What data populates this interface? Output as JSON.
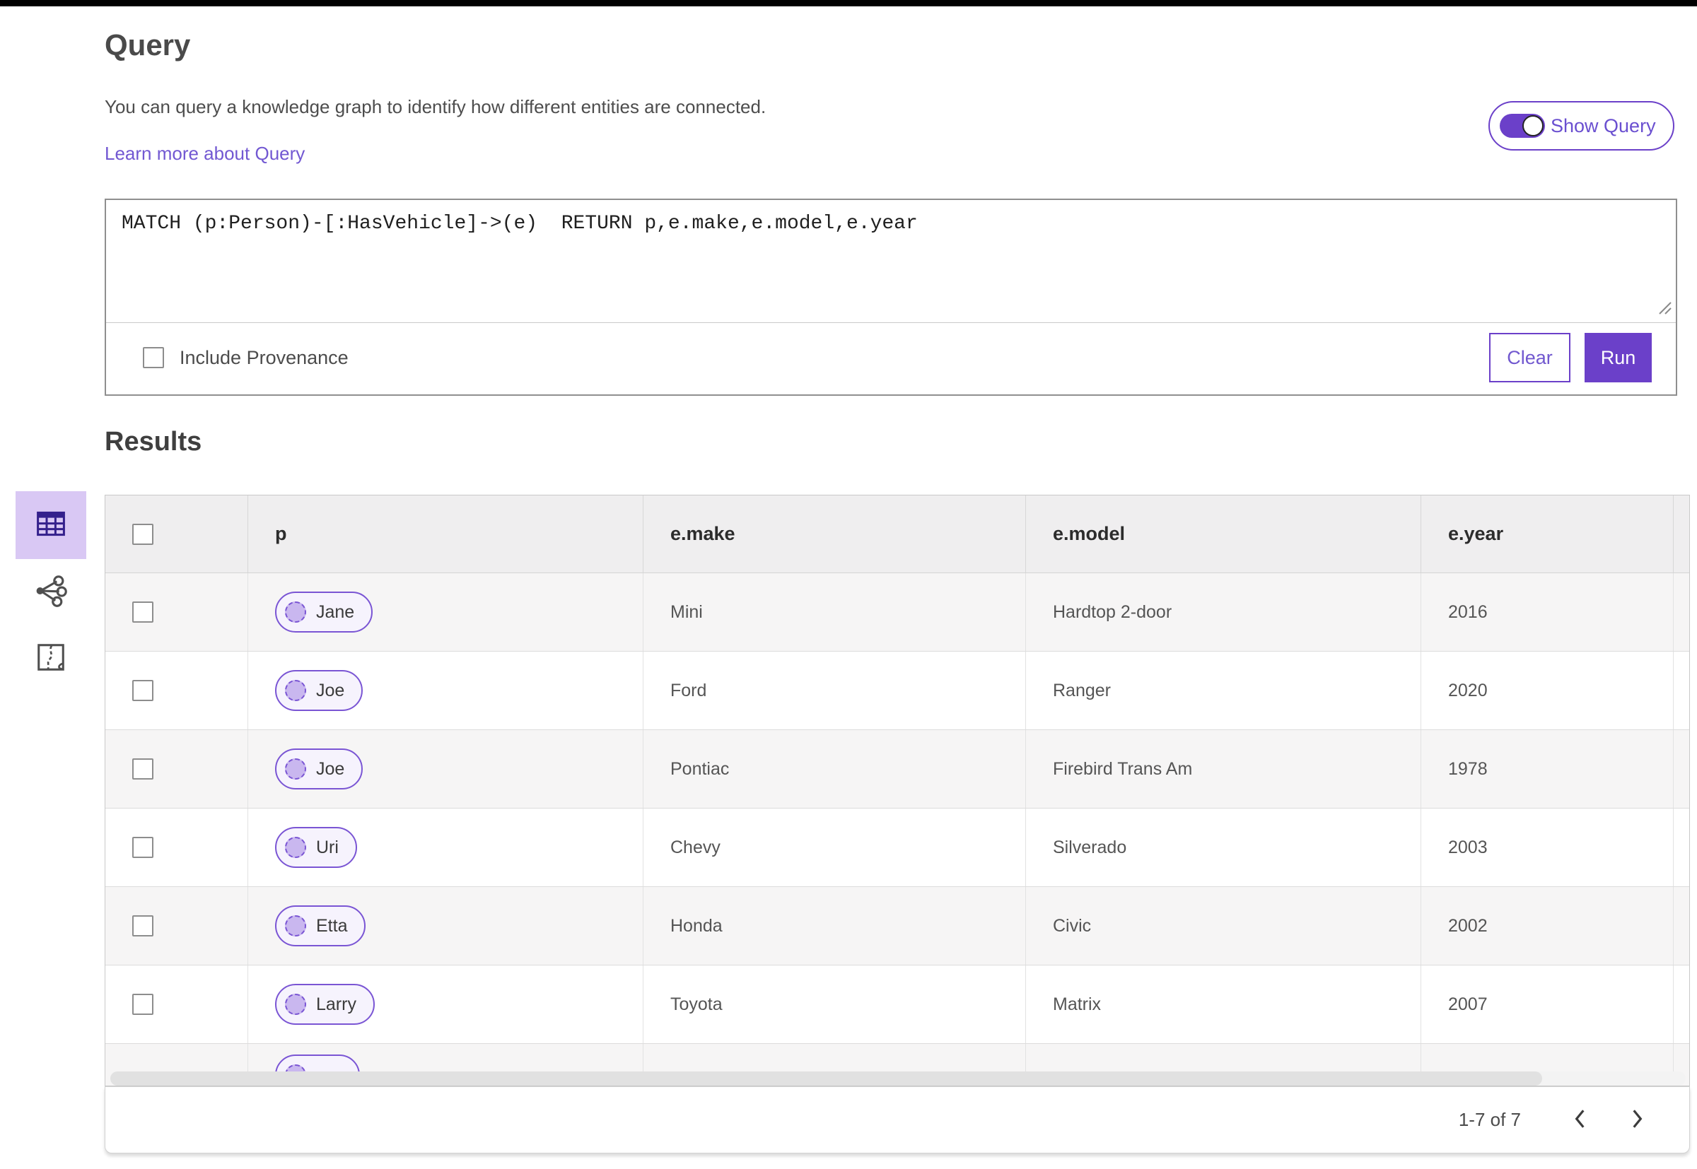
{
  "colors": {
    "accent_purple": "#6b40c9",
    "pill_border_purple": "#7a55d4",
    "pill_node_fill": "#c9b7ef",
    "selected_tile_bg": "#d9c8f4",
    "link_purple": "#7258d2",
    "header_bg": "#efeeef",
    "row_alt_bg": "#f6f5f5"
  },
  "query_panel": {
    "title": "Query",
    "description": "You can query a knowledge graph to identify how different entities are connected.",
    "learn_more_link": "Learn more about Query",
    "show_query_toggle": {
      "label": "Show Query",
      "state": "on"
    },
    "query_input": {
      "value": "MATCH (p:Person)-[:HasVehicle]->(e)  RETURN p,e.make,e.model,e.year"
    },
    "include_provenance": {
      "label": "Include Provenance",
      "checked": false
    },
    "buttons": {
      "clear": "Clear",
      "run": "Run"
    }
  },
  "results_panel": {
    "title": "Results",
    "view_tabs": [
      {
        "name": "table-view",
        "icon": "table-icon",
        "selected": true
      },
      {
        "name": "link-chart-view",
        "icon": "link-chart-icon",
        "selected": false
      },
      {
        "name": "map-view",
        "icon": "map-icon",
        "selected": false
      }
    ],
    "table": {
      "columns": [
        "p",
        "e.make",
        "e.model",
        "e.year"
      ],
      "rows": [
        {
          "p": "Jane",
          "e_make": "Mini",
          "e_model": "Hardtop 2-door",
          "e_year": "2016"
        },
        {
          "p": "Joe",
          "e_make": "Ford",
          "e_model": "Ranger",
          "e_year": "2020"
        },
        {
          "p": "Joe",
          "e_make": "Pontiac",
          "e_model": "Firebird Trans Am",
          "e_year": "1978"
        },
        {
          "p": "Uri",
          "e_make": "Chevy",
          "e_model": "Silverado",
          "e_year": "2003"
        },
        {
          "p": "Etta",
          "e_make": "Honda",
          "e_model": "Civic",
          "e_year": "2002"
        },
        {
          "p": "Larry",
          "e_make": "Toyota",
          "e_model": "Matrix",
          "e_year": "2007"
        }
      ],
      "partial_row_visible": true,
      "all_checkboxes_unchecked": true
    },
    "pagination": {
      "range_label": "1-7 of 7"
    }
  }
}
